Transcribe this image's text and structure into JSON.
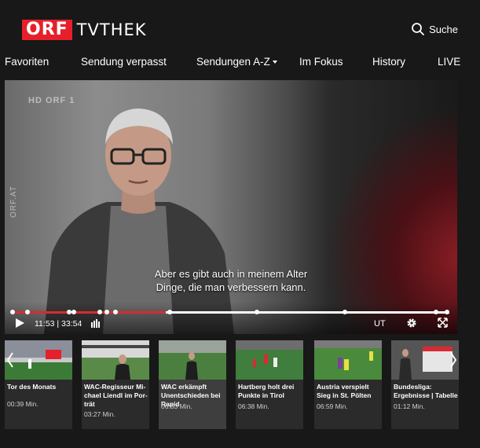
{
  "header": {
    "logo_orf": "ORF",
    "logo_tvthek": "TVTHEK",
    "search_label": "Suche",
    "brand_color": "#e6202b"
  },
  "nav": [
    {
      "label": "Favoriten"
    },
    {
      "label": "Sendung verpasst"
    },
    {
      "label": "Sendungen A-Z"
    },
    {
      "label": "Im Fokus"
    },
    {
      "label": "History"
    },
    {
      "label": "LIVE"
    }
  ],
  "player": {
    "watermark": "HD ORF 1",
    "side_logo": "ORF.AT",
    "subtitle_line1": "Aber es gibt auch in meinem Alter",
    "subtitle_line2": "Dinge, die man verbessern kann.",
    "time_display": "11:53 | 33:54",
    "progress_fraction": 0.351,
    "chapter_markers": [
      0.0,
      0.035,
      0.13,
      0.14,
      0.2,
      0.215,
      0.235,
      0.36,
      0.56,
      0.76,
      0.97,
      0.995
    ],
    "subtitles_button": "UT",
    "icons": [
      "play-icon",
      "volume-icon",
      "settings-icon",
      "fullscreen-icon"
    ],
    "progress_color": "#d92a33"
  },
  "carousel": {
    "items": [
      {
        "title": "Tor des Monats",
        "duration": "00:39 Min."
      },
      {
        "title": "WAC-Regisseur Mi­chael Liendl im Por­trät",
        "duration": "03:27 Min."
      },
      {
        "title": "WAC erkämpft Unent­schieden bei Rapid",
        "duration": "06:53 Min."
      },
      {
        "title": "Hartberg holt drei Punkte in Tirol",
        "duration": "06:38 Min."
      },
      {
        "title": "Austria verspielt Sieg in St. Pölten",
        "duration": "06:59 Min."
      },
      {
        "title": "Bundesliga: Ergebnis­se | Tabelle",
        "duration": "01:12 Min."
      }
    ]
  }
}
